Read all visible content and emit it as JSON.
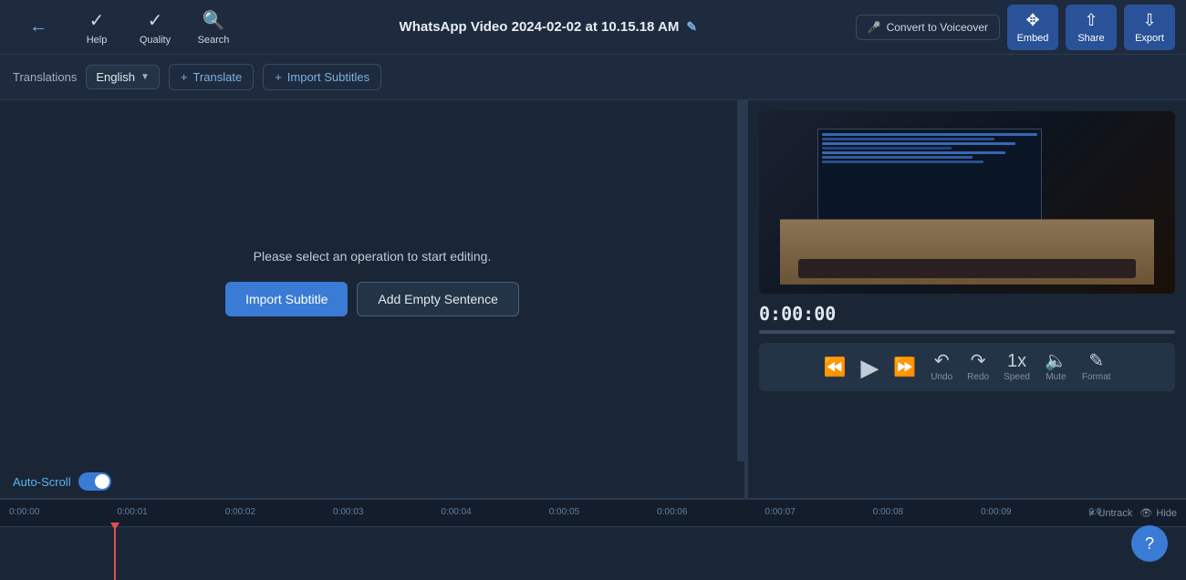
{
  "app": {
    "title": "WhatsApp Video 2024-02-02 at 10.15.18 AM"
  },
  "navbar": {
    "back_label": "Back",
    "help_label": "Help",
    "quality_label": "Quality",
    "search_label": "Search",
    "convert_label": "Convert to Voiceover",
    "embed_label": "Embed",
    "share_label": "Share",
    "export_label": "Export"
  },
  "subtitle_bar": {
    "translations_label": "Translations",
    "language": "English",
    "translate_label": "Translate",
    "import_subtitles_label": "Import Subtitles"
  },
  "editing": {
    "prompt": "Please select an operation to start editing.",
    "import_subtitle_btn": "Import Subtitle",
    "add_empty_sentence_btn": "Add Empty Sentence",
    "auto_scroll_label": "Auto-Scroll"
  },
  "video": {
    "time": "0:00:00"
  },
  "controls": {
    "undo_label": "Undo",
    "redo_label": "Redo",
    "speed_label": "Speed",
    "speed_value": "1x",
    "mute_label": "Mute",
    "format_label": "Format"
  },
  "timeline": {
    "timestamps": [
      "0:00:00",
      "0:00:01",
      "0:00:02",
      "0:00:03",
      "0:00:04",
      "0:00:05",
      "0:00:06",
      "0:00:07",
      "0:00:08",
      "0:00:09",
      "0:0"
    ],
    "untrack_label": "Untrack",
    "hide_label": "Hide"
  },
  "help": {
    "label": "?"
  }
}
